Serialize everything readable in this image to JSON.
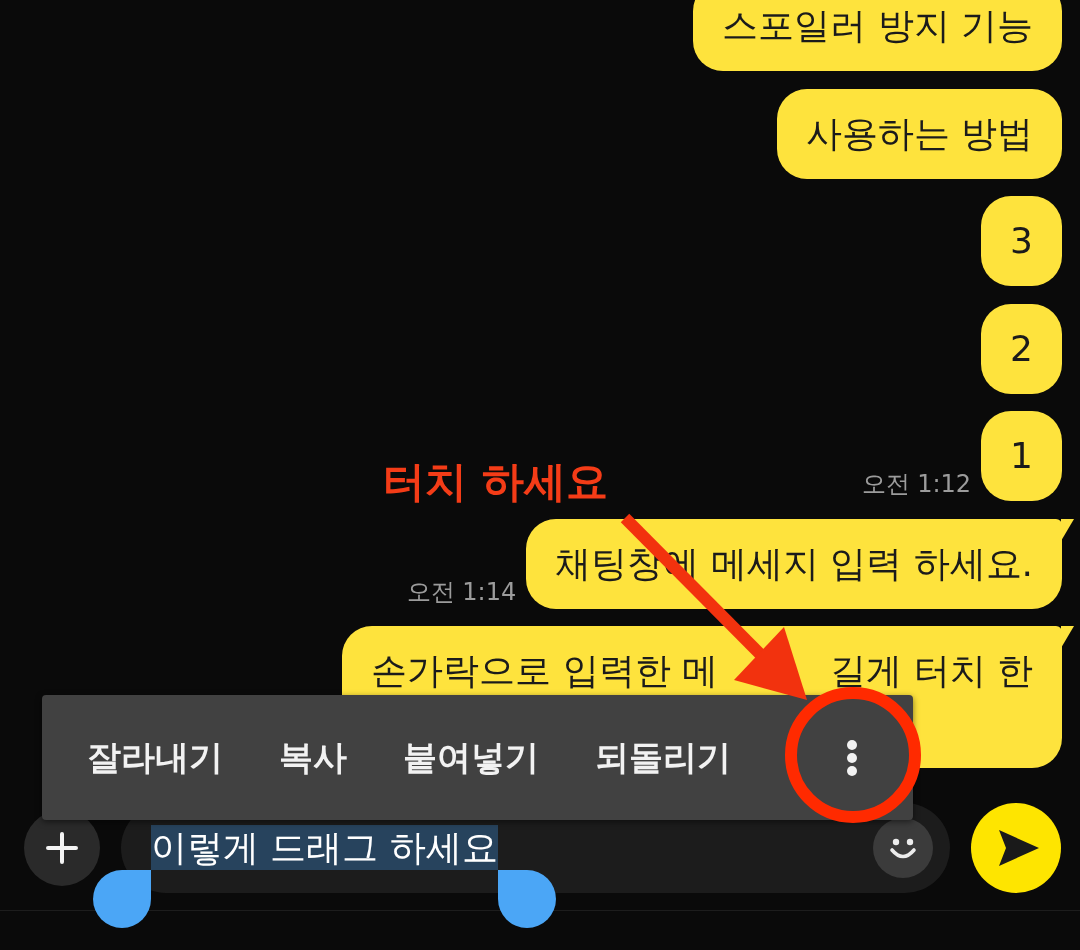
{
  "chat": {
    "messages": [
      {
        "text": "스포일러 방지 기능",
        "tail": false
      },
      {
        "text": "사용하는 방법",
        "tail": false
      },
      {
        "text": "3",
        "tail": false
      },
      {
        "text": "2",
        "tail": false
      },
      {
        "text": "1",
        "time": "오전 1:12",
        "tail": false
      },
      {
        "text": "채팅창에 메세지 입력 하세요.",
        "time": "오전 1:14",
        "tail": true
      },
      {
        "text_parts": [
          "손가락으로 입력한 메",
          "길게 터치 한"
        ],
        "tail": true
      }
    ]
  },
  "annotation": {
    "label": "터치 하세요"
  },
  "text_toolbar": {
    "actions": [
      {
        "label": "잘라내기"
      },
      {
        "label": "복사"
      },
      {
        "label": "붙여넣기"
      },
      {
        "label": "되돌리기"
      }
    ]
  },
  "composer": {
    "value": "이렇게 드래그 하세요",
    "text_selected": true
  }
}
